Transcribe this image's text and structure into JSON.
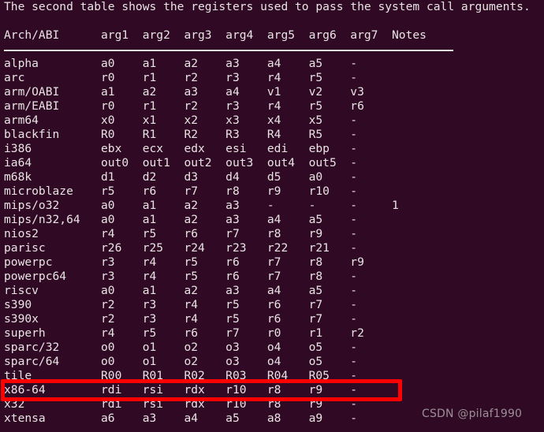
{
  "terminal": {
    "background_color": "#300a24",
    "text_color": "#e9e4e4",
    "intro_text": "The second table shows the registers used to pass the system call arguments.",
    "blank_line": "",
    "column_header_line": "Arch/ABI      arg1  arg2  arg3  arg4  arg5  arg6  arg7  Notes",
    "columns": [
      "Arch/ABI",
      "arg1",
      "arg2",
      "arg3",
      "arg4",
      "arg5",
      "arg6",
      "arg7",
      "Notes"
    ],
    "rows": [
      {
        "line": "alpha         a0    a1    a2    a3    a4    a5    -"
      },
      {
        "line": "arc           r0    r1    r2    r3    r4    r5    -"
      },
      {
        "line": "arm/OABI      a1    a2    a3    a4    v1    v2    v3"
      },
      {
        "line": "arm/EABI      r0    r1    r2    r3    r4    r5    r6"
      },
      {
        "line": "arm64         x0    x1    x2    x3    x4    x5    -"
      },
      {
        "line": "blackfin      R0    R1    R2    R3    R4    R5    -"
      },
      {
        "line": "i386          ebx   ecx   edx   esi   edi   ebp   -"
      },
      {
        "line": "ia64          out0  out1  out2  out3  out4  out5  -"
      },
      {
        "line": "m68k          d1    d2    d3    d4    d5    a0    -"
      },
      {
        "line": "microblaze    r5    r6    r7    r8    r9    r10   -"
      },
      {
        "line": "mips/o32      a0    a1    a2    a3    -     -     -     1"
      },
      {
        "line": "mips/n32,64   a0    a1    a2    a3    a4    a5    -"
      },
      {
        "line": "nios2         r4    r5    r6    r7    r8    r9    -"
      },
      {
        "line": "parisc        r26   r25   r24   r23   r22   r21   -"
      },
      {
        "line": "powerpc       r3    r4    r5    r6    r7    r8    r9"
      },
      {
        "line": "powerpc64     r3    r4    r5    r6    r7    r8    -"
      },
      {
        "line": "riscv         a0    a1    a2    a3    a4    a5    -"
      },
      {
        "line": "s390          r2    r3    r4    r5    r6    r7    -"
      },
      {
        "line": "s390x         r2    r3    r4    r5    r6    r7    -"
      },
      {
        "line": "superh        r4    r5    r6    r7    r0    r1    r2"
      },
      {
        "line": "sparc/32      o0    o1    o2    o3    o4    o5    -"
      },
      {
        "line": "sparc/64      o0    o1    o2    o3    o4    o5    -"
      },
      {
        "line": "tile          R00   R01   R02   R03   R04   R05   -"
      },
      {
        "line": "x86-64        rdi   rsi   rdx   r10   r8    r9    -"
      },
      {
        "line": "x32           rdi   rsi   rdx   r10   r8    r9    -"
      },
      {
        "line": "xtensa        a6    a3    a4    a5    a8    a9    -"
      }
    ],
    "table_data": [
      {
        "arch": "alpha",
        "arg1": "a0",
        "arg2": "a1",
        "arg3": "a2",
        "arg4": "a3",
        "arg5": "a4",
        "arg6": "a5",
        "arg7": "-",
        "notes": ""
      },
      {
        "arch": "arc",
        "arg1": "r0",
        "arg2": "r1",
        "arg3": "r2",
        "arg4": "r3",
        "arg5": "r4",
        "arg6": "r5",
        "arg7": "-",
        "notes": ""
      },
      {
        "arch": "arm/OABI",
        "arg1": "a1",
        "arg2": "a2",
        "arg3": "a3",
        "arg4": "a4",
        "arg5": "v1",
        "arg6": "v2",
        "arg7": "v3",
        "notes": ""
      },
      {
        "arch": "arm/EABI",
        "arg1": "r0",
        "arg2": "r1",
        "arg3": "r2",
        "arg4": "r3",
        "arg5": "r4",
        "arg6": "r5",
        "arg7": "r6",
        "notes": ""
      },
      {
        "arch": "arm64",
        "arg1": "x0",
        "arg2": "x1",
        "arg3": "x2",
        "arg4": "x3",
        "arg5": "x4",
        "arg6": "x5",
        "arg7": "-",
        "notes": ""
      },
      {
        "arch": "blackfin",
        "arg1": "R0",
        "arg2": "R1",
        "arg3": "R2",
        "arg4": "R3",
        "arg5": "R4",
        "arg6": "R5",
        "arg7": "-",
        "notes": ""
      },
      {
        "arch": "i386",
        "arg1": "ebx",
        "arg2": "ecx",
        "arg3": "edx",
        "arg4": "esi",
        "arg5": "edi",
        "arg6": "ebp",
        "arg7": "-",
        "notes": ""
      },
      {
        "arch": "ia64",
        "arg1": "out0",
        "arg2": "out1",
        "arg3": "out2",
        "arg4": "out3",
        "arg5": "out4",
        "arg6": "out5",
        "arg7": "-",
        "notes": ""
      },
      {
        "arch": "m68k",
        "arg1": "d1",
        "arg2": "d2",
        "arg3": "d3",
        "arg4": "d4",
        "arg5": "d5",
        "arg6": "a0",
        "arg7": "-",
        "notes": ""
      },
      {
        "arch": "microblaze",
        "arg1": "r5",
        "arg2": "r6",
        "arg3": "r7",
        "arg4": "r8",
        "arg5": "r9",
        "arg6": "r10",
        "arg7": "-",
        "notes": ""
      },
      {
        "arch": "mips/o32",
        "arg1": "a0",
        "arg2": "a1",
        "arg3": "a2",
        "arg4": "a3",
        "arg5": "-",
        "arg6": "-",
        "arg7": "-",
        "notes": "1"
      },
      {
        "arch": "mips/n32,64",
        "arg1": "a0",
        "arg2": "a1",
        "arg3": "a2",
        "arg4": "a3",
        "arg5": "a4",
        "arg6": "a5",
        "arg7": "-",
        "notes": ""
      },
      {
        "arch": "nios2",
        "arg1": "r4",
        "arg2": "r5",
        "arg3": "r6",
        "arg4": "r7",
        "arg5": "r8",
        "arg6": "r9",
        "arg7": "-",
        "notes": ""
      },
      {
        "arch": "parisc",
        "arg1": "r26",
        "arg2": "r25",
        "arg3": "r24",
        "arg4": "r23",
        "arg5": "r22",
        "arg6": "r21",
        "arg7": "-",
        "notes": ""
      },
      {
        "arch": "powerpc",
        "arg1": "r3",
        "arg2": "r4",
        "arg3": "r5",
        "arg4": "r6",
        "arg5": "r7",
        "arg6": "r8",
        "arg7": "r9",
        "notes": ""
      },
      {
        "arch": "powerpc64",
        "arg1": "r3",
        "arg2": "r4",
        "arg3": "r5",
        "arg4": "r6",
        "arg5": "r7",
        "arg6": "r8",
        "arg7": "-",
        "notes": ""
      },
      {
        "arch": "riscv",
        "arg1": "a0",
        "arg2": "a1",
        "arg3": "a2",
        "arg4": "a3",
        "arg5": "a4",
        "arg6": "a5",
        "arg7": "-",
        "notes": ""
      },
      {
        "arch": "s390",
        "arg1": "r2",
        "arg2": "r3",
        "arg3": "r4",
        "arg4": "r5",
        "arg5": "r6",
        "arg6": "r7",
        "arg7": "-",
        "notes": ""
      },
      {
        "arch": "s390x",
        "arg1": "r2",
        "arg2": "r3",
        "arg3": "r4",
        "arg4": "r5",
        "arg5": "r6",
        "arg6": "r7",
        "arg7": "-",
        "notes": ""
      },
      {
        "arch": "superh",
        "arg1": "r4",
        "arg2": "r5",
        "arg3": "r6",
        "arg4": "r7",
        "arg5": "r0",
        "arg6": "r1",
        "arg7": "r2",
        "notes": ""
      },
      {
        "arch": "sparc/32",
        "arg1": "o0",
        "arg2": "o1",
        "arg3": "o2",
        "arg4": "o3",
        "arg5": "o4",
        "arg6": "o5",
        "arg7": "-",
        "notes": ""
      },
      {
        "arch": "sparc/64",
        "arg1": "o0",
        "arg2": "o1",
        "arg3": "o2",
        "arg4": "o3",
        "arg5": "o4",
        "arg6": "o5",
        "arg7": "-",
        "notes": ""
      },
      {
        "arch": "tile",
        "arg1": "R00",
        "arg2": "R01",
        "arg3": "R02",
        "arg4": "R03",
        "arg5": "R04",
        "arg6": "R05",
        "arg7": "-",
        "notes": ""
      },
      {
        "arch": "x86-64",
        "arg1": "rdi",
        "arg2": "rsi",
        "arg3": "rdx",
        "arg4": "r10",
        "arg5": "r8",
        "arg6": "r9",
        "arg7": "-",
        "notes": ""
      },
      {
        "arch": "x32",
        "arg1": "rdi",
        "arg2": "rsi",
        "arg3": "rdx",
        "arg4": "r10",
        "arg5": "r8",
        "arg6": "r9",
        "arg7": "-",
        "notes": ""
      },
      {
        "arch": "xtensa",
        "arg1": "a6",
        "arg2": "a3",
        "arg3": "a4",
        "arg4": "a5",
        "arg5": "a8",
        "arg6": "a9",
        "arg7": "-",
        "notes": ""
      }
    ]
  },
  "annotation": {
    "highlight_color": "#fe0000",
    "highlighted_row_arch": "x86-64"
  },
  "watermark": {
    "text": "CSDN @pilaf1990",
    "color": "#9b8f97"
  }
}
